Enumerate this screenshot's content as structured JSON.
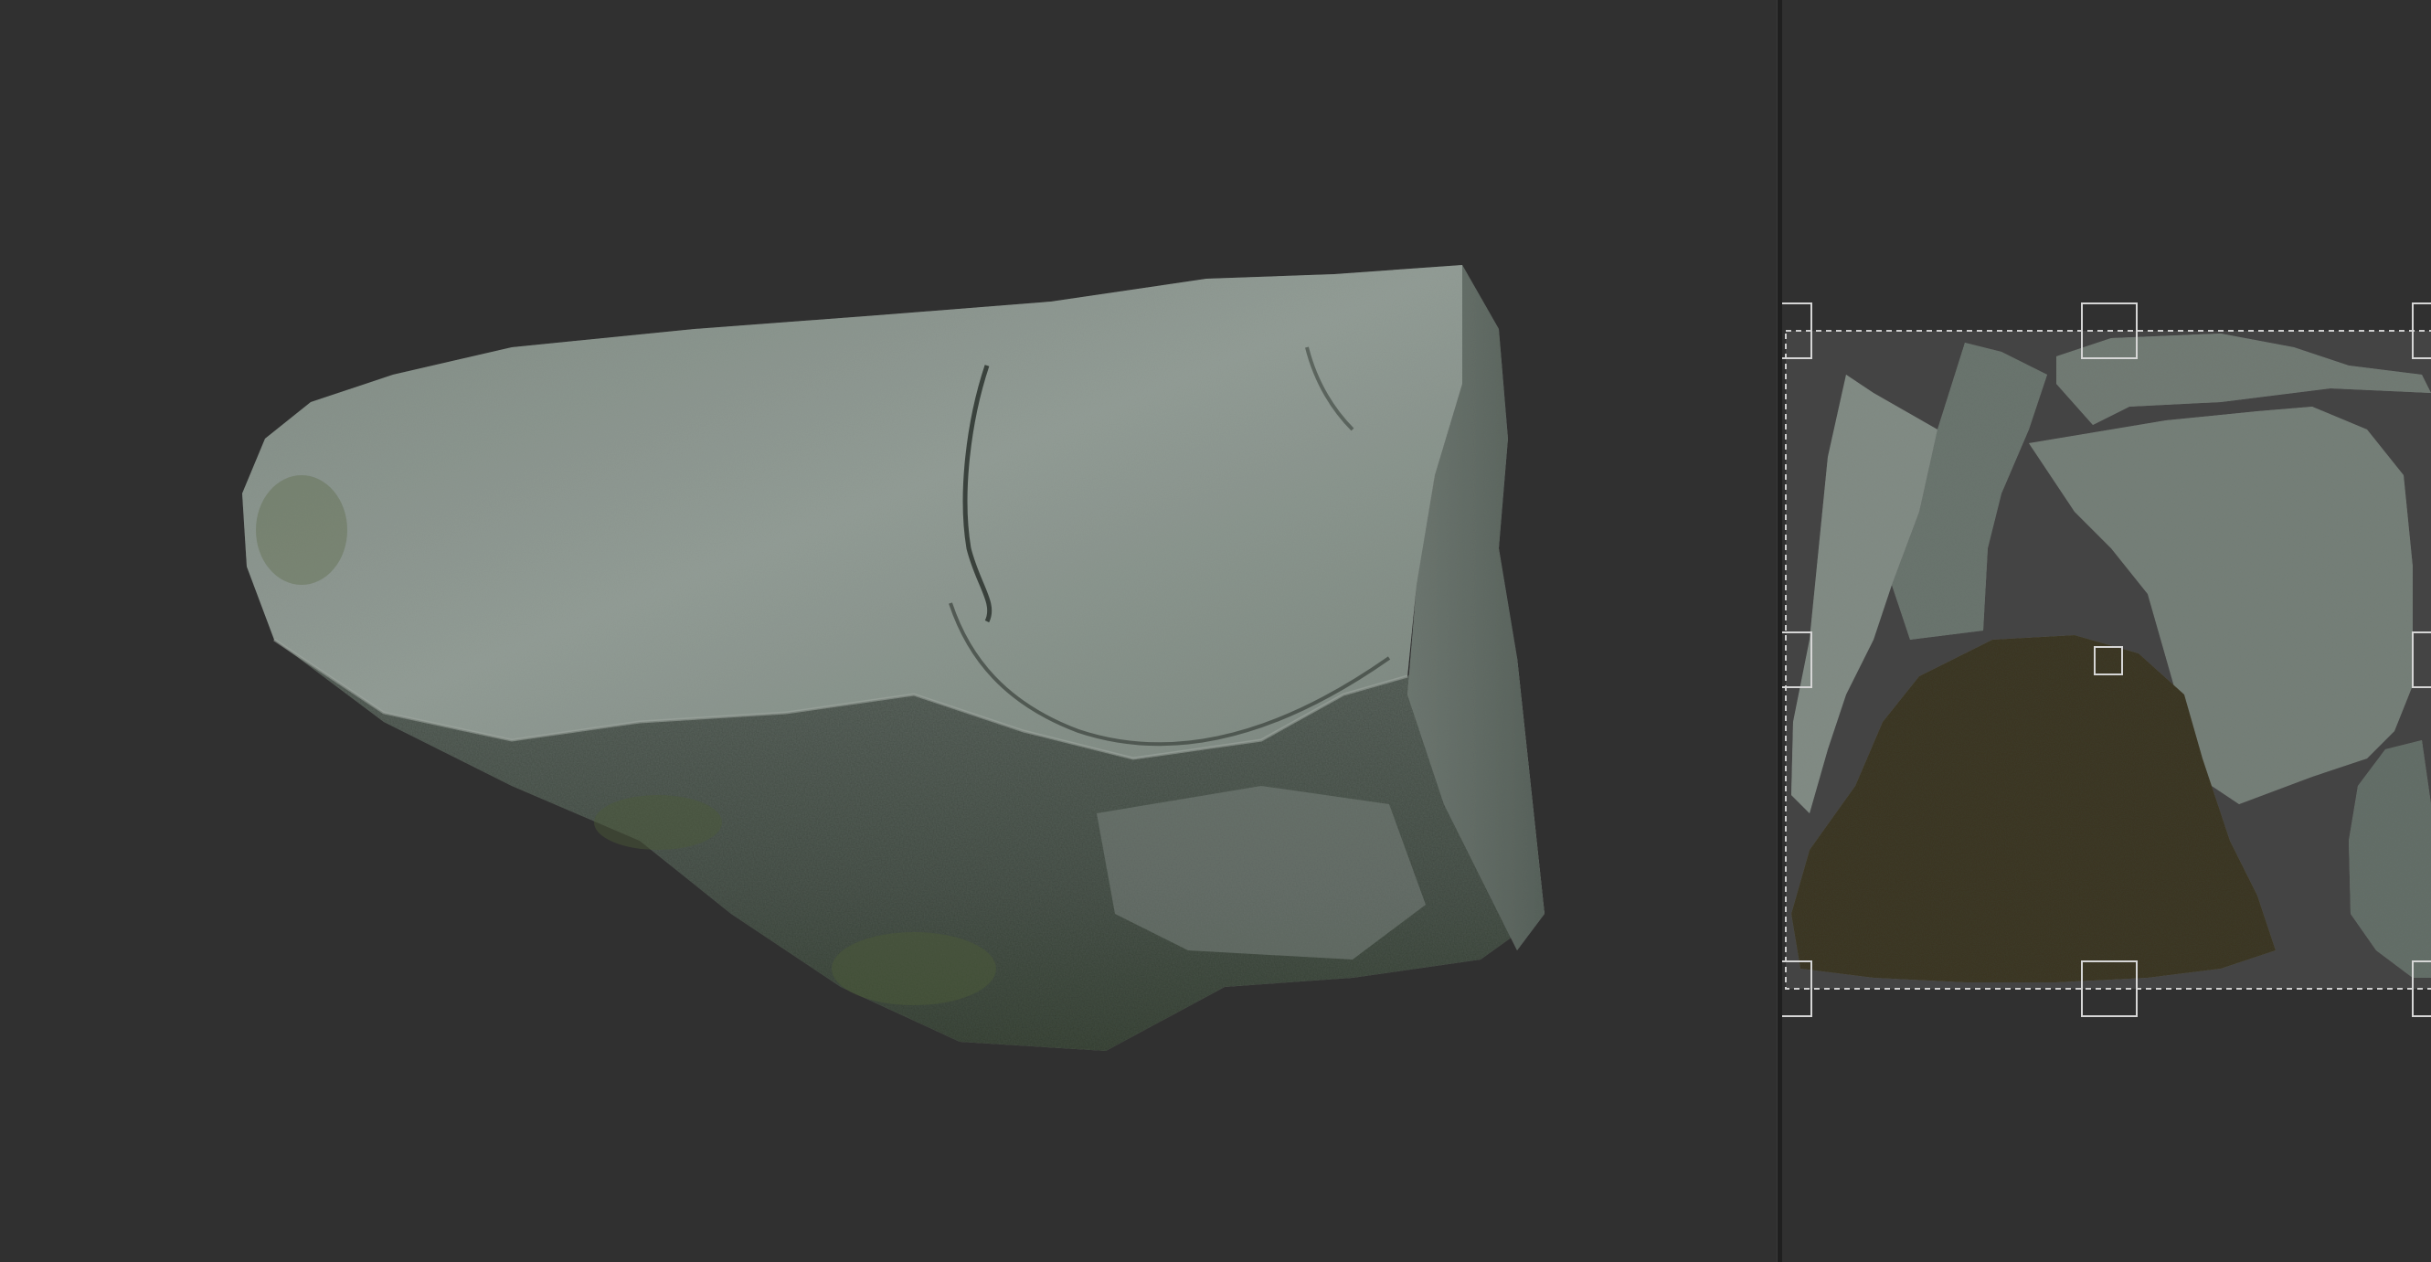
{
  "app": {
    "panels": [
      "3d-viewport",
      "uv-texture-view"
    ]
  },
  "viewport": {
    "background": "#303030",
    "object": "rock-mesh"
  },
  "uv_view": {
    "background": "#303030",
    "uv_area_fill": "#444444",
    "selection_border": "#cfcfcf",
    "handle_color": "#d6d6d6"
  },
  "colors": {
    "rock_light": "#8c958f",
    "rock_mid": "#6b746e",
    "rock_dark": "#3f4641",
    "rock_moss": "#4d5a3e",
    "rock_brown": "#3b3726"
  }
}
